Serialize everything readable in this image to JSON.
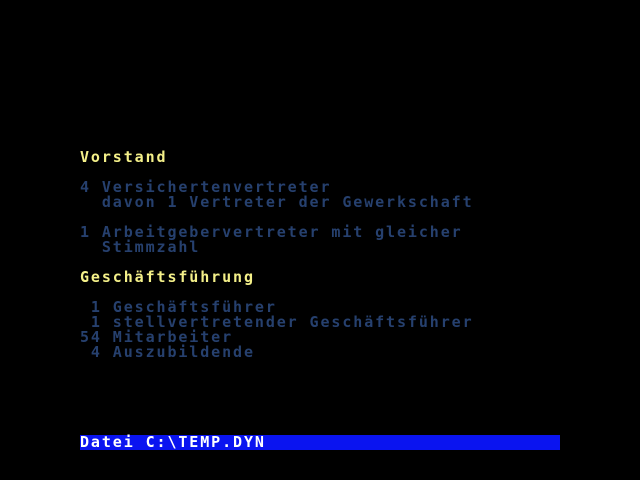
{
  "document": {
    "section_vorstand": {
      "heading": "Vorstand",
      "lines": [
        "4 Versichertenvertreter",
        "  davon 1 Vertreter der Gewerkschaft",
        "1 Arbeitgebervertreter mit gleicher",
        "  Stimmzahl"
      ]
    },
    "section_geschaeftsfuehrung": {
      "heading": "Geschäftsführung",
      "lines": [
        " 1 Geschäftsführer",
        " 1 stellvertretender Geschäftsführer",
        "54 Mitarbeiter",
        " 4 Auszubildende"
      ]
    }
  },
  "status_bar": {
    "label": "Datei C:\\TEMP.DYN"
  },
  "colors": {
    "background": "#000000",
    "heading": "#f4f089",
    "body_text": "#26406e",
    "status_bar_bg": "#0a14f0",
    "status_bar_text": "#ffffff"
  }
}
